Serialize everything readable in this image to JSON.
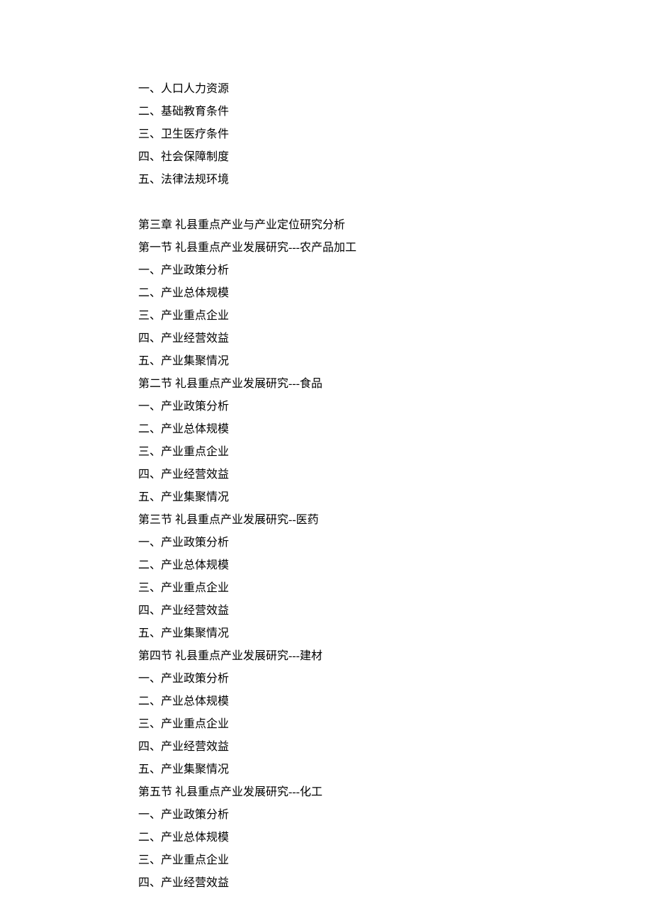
{
  "lines": [
    "一、人口人力资源",
    "二、基础教育条件",
    "三、卫生医疗条件",
    "四、社会保障制度",
    "五、法律法规环境",
    "",
    "第三章  礼县重点产业与产业定位研究分析",
    "第一节  礼县重点产业发展研究---农产品加工",
    "一、产业政策分析",
    "二、产业总体规模",
    "三、产业重点企业",
    "四、产业经营效益",
    "五、产业集聚情况",
    "第二节  礼县重点产业发展研究---食品",
    "一、产业政策分析",
    "二、产业总体规模",
    "三、产业重点企业",
    "四、产业经营效益",
    "五、产业集聚情况",
    "第三节  礼县重点产业发展研究--医药",
    "一、产业政策分析",
    "二、产业总体规模",
    "三、产业重点企业",
    "四、产业经营效益",
    "五、产业集聚情况",
    "第四节  礼县重点产业发展研究---建材",
    "一、产业政策分析",
    "二、产业总体规模",
    "三、产业重点企业",
    "四、产业经营效益",
    "五、产业集聚情况",
    "第五节  礼县重点产业发展研究---化工",
    "一、产业政策分析",
    "二、产业总体规模",
    "三、产业重点企业",
    "四、产业经营效益"
  ]
}
